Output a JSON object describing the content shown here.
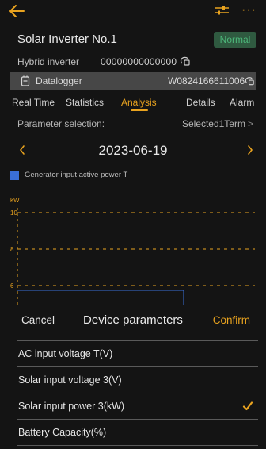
{
  "header": {
    "device_title": "Solar Inverter No.1",
    "status": "Normal",
    "device_type": "Hybrid inverter",
    "device_sn": "00000000000000"
  },
  "datalogger": {
    "label": "Datalogger",
    "sn": "W0824166611006"
  },
  "tabs": [
    {
      "label": "Real Time"
    },
    {
      "label": "Statistics"
    },
    {
      "label": "Analysis"
    },
    {
      "label": "Details"
    },
    {
      "label": "Alarm"
    }
  ],
  "parameter": {
    "label": "Parameter selection:",
    "value": "Selected1Term",
    "chevron": ">"
  },
  "date": {
    "label": "2023-06-19"
  },
  "chart_data": {
    "type": "line",
    "series": [
      {
        "name": "Generator input active power T",
        "values": []
      }
    ],
    "ylabel": "kW",
    "y_ticks": [
      "10",
      "8",
      "6"
    ],
    "grid": true
  },
  "sheet": {
    "cancel": "Cancel",
    "title": "Device parameters",
    "confirm": "Confirm",
    "items": [
      {
        "label": "AC input voltage T(V)",
        "checked": false
      },
      {
        "label": "Solar input voltage 3(V)",
        "checked": false
      },
      {
        "label": "Solar input power 3(kW)",
        "checked": true
      },
      {
        "label": "Battery Capacity(%)",
        "checked": false
      }
    ]
  },
  "colors": {
    "accent": "#e9a31f",
    "status_green": "#4db87a",
    "series_blue": "#3a6fd8"
  },
  "icons": [
    "back-arrow-icon",
    "filter-icon",
    "more-icon",
    "copy-icon",
    "datalogger-icon",
    "chevron-left-icon",
    "chevron-right-icon",
    "check-icon"
  ]
}
